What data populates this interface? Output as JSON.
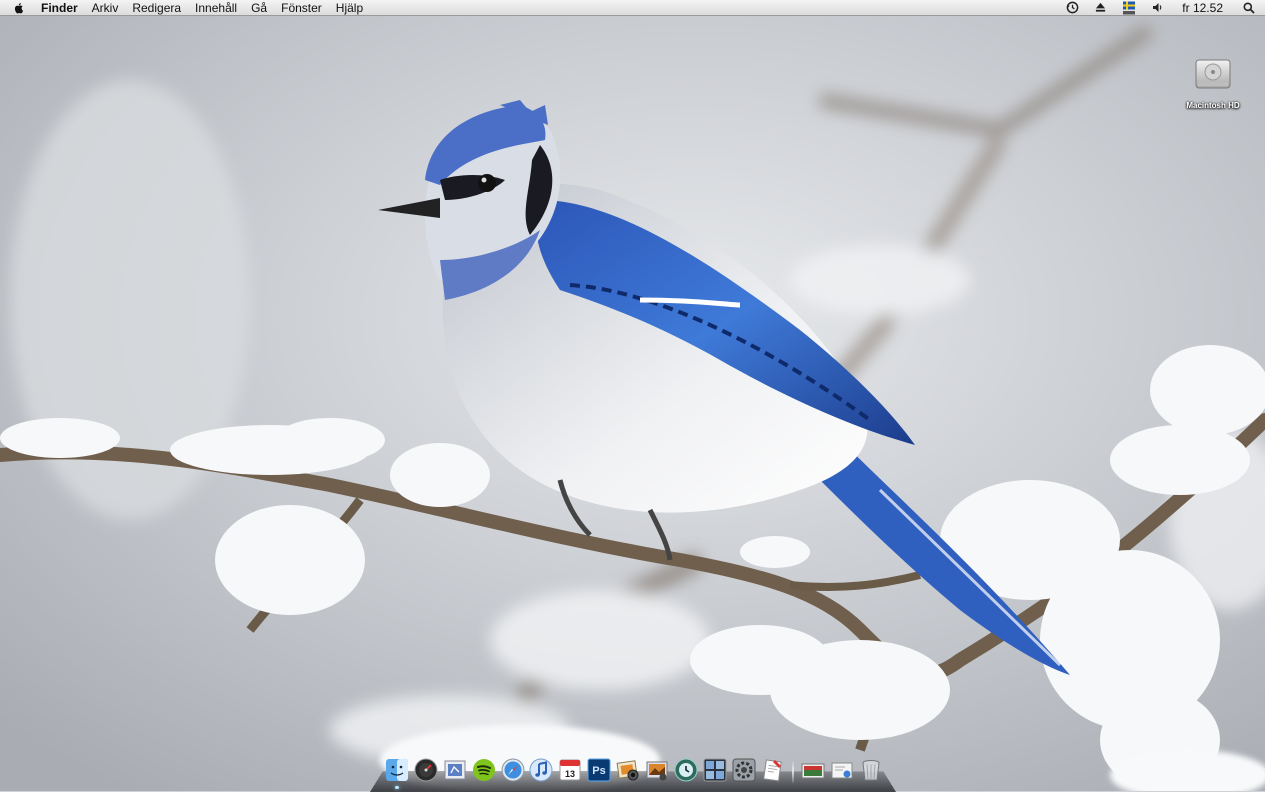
{
  "menubar": {
    "app_name": "Finder",
    "menus": [
      "Arkiv",
      "Redigera",
      "Innehåll",
      "Gå",
      "Fönster",
      "Hjälp"
    ],
    "extras": [
      "time-machine-icon",
      "eject-icon",
      "input-menu-swedish-pro-icon",
      "volume-icon"
    ],
    "clock": "fr 12.52"
  },
  "desktop": {
    "icons": [
      {
        "label": "Macintosh HD",
        "icon": "hard-drive-icon"
      }
    ]
  },
  "dock": {
    "apps": [
      {
        "icon": "finder-icon",
        "running": true
      },
      {
        "icon": "dashboard-icon",
        "running": false
      },
      {
        "icon": "mail-icon",
        "running": false
      },
      {
        "icon": "spotify-icon",
        "running": false
      },
      {
        "icon": "safari-icon",
        "running": false
      },
      {
        "icon": "itunes-icon",
        "running": false
      },
      {
        "icon": "ical-icon",
        "label": "13",
        "running": false
      },
      {
        "icon": "photoshop-icon",
        "label": "Ps",
        "running": false
      },
      {
        "icon": "iphoto-icon",
        "running": false
      },
      {
        "icon": "image-capture-icon",
        "running": false
      },
      {
        "icon": "time-machine-icon",
        "running": false
      },
      {
        "icon": "spaces-icon",
        "running": false
      },
      {
        "icon": "system-preferences-icon",
        "running": false
      },
      {
        "icon": "textedit-icon",
        "running": false
      }
    ],
    "stacks": [
      {
        "icon": "documents-stack-icon"
      },
      {
        "icon": "downloads-stack-icon"
      },
      {
        "icon": "trash-icon"
      }
    ]
  },
  "wallpaper": "blue jay on snowy branch",
  "colors": {
    "menubar": "#e8e8e8",
    "snow": "#f4f6f8",
    "jay_blue": "#4a6fc2"
  }
}
